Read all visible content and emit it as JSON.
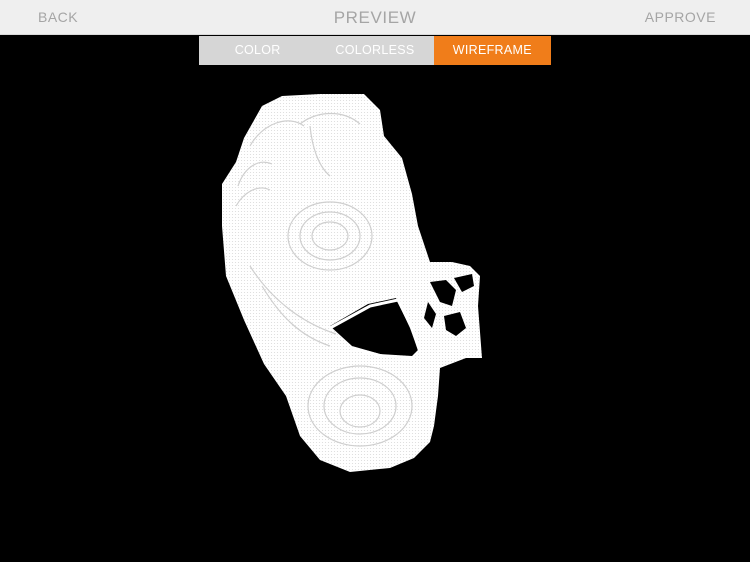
{
  "nav": {
    "back_label": "BACK",
    "title": "PREVIEW",
    "approve_label": "APPROVE"
  },
  "view_modes": [
    {
      "label": "COLOR",
      "active": false
    },
    {
      "label": "COLORLESS",
      "active": false
    },
    {
      "label": "WIREFRAME",
      "active": true
    }
  ],
  "colors": {
    "nav_background": "#efefef",
    "nav_text": "#a5a5a5",
    "segment_inactive": "#d6d6d6",
    "segment_active": "#f07d1a",
    "viewport_background": "#000000",
    "model": "#ffffff"
  },
  "icons": {
    "model": "foot-scan-wireframe"
  }
}
